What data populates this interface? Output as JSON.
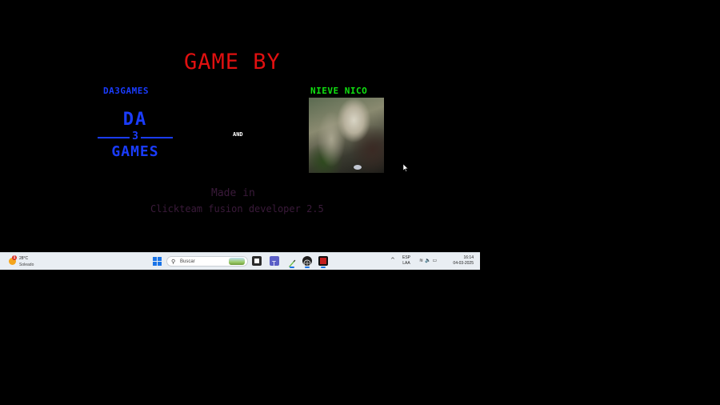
{
  "game": {
    "title": "GAME BY",
    "studio": {
      "name": "DA3GAMES",
      "logo_line1": "DA",
      "logo_line2": "3",
      "logo_line3": "GAMES"
    },
    "and_label": "AND",
    "artist": {
      "name": "NIEVE NICO"
    },
    "made_in": "Made in",
    "tool": "Clickteam fusion developer 2.5"
  },
  "taskbar": {
    "weather": {
      "temp": "28°C",
      "condition": "Soleado",
      "badge": "1"
    },
    "search_placeholder": "Buscar",
    "lang_line1": "ESP",
    "lang_line2": "LAA",
    "time": "16:14",
    "date": "04-03-2025",
    "icons": [
      "windows-icon",
      "search-icon",
      "file-explorer-icon",
      "teams-icon",
      "pen-icon",
      "browser-icon",
      "game-icon"
    ]
  },
  "colors": {
    "title": "#e01010",
    "studio": "#1a3cff",
    "artist": "#10e010",
    "credits": "#3a1a3a",
    "taskbar": "#e9eef3",
    "accent": "#1a74e8"
  }
}
